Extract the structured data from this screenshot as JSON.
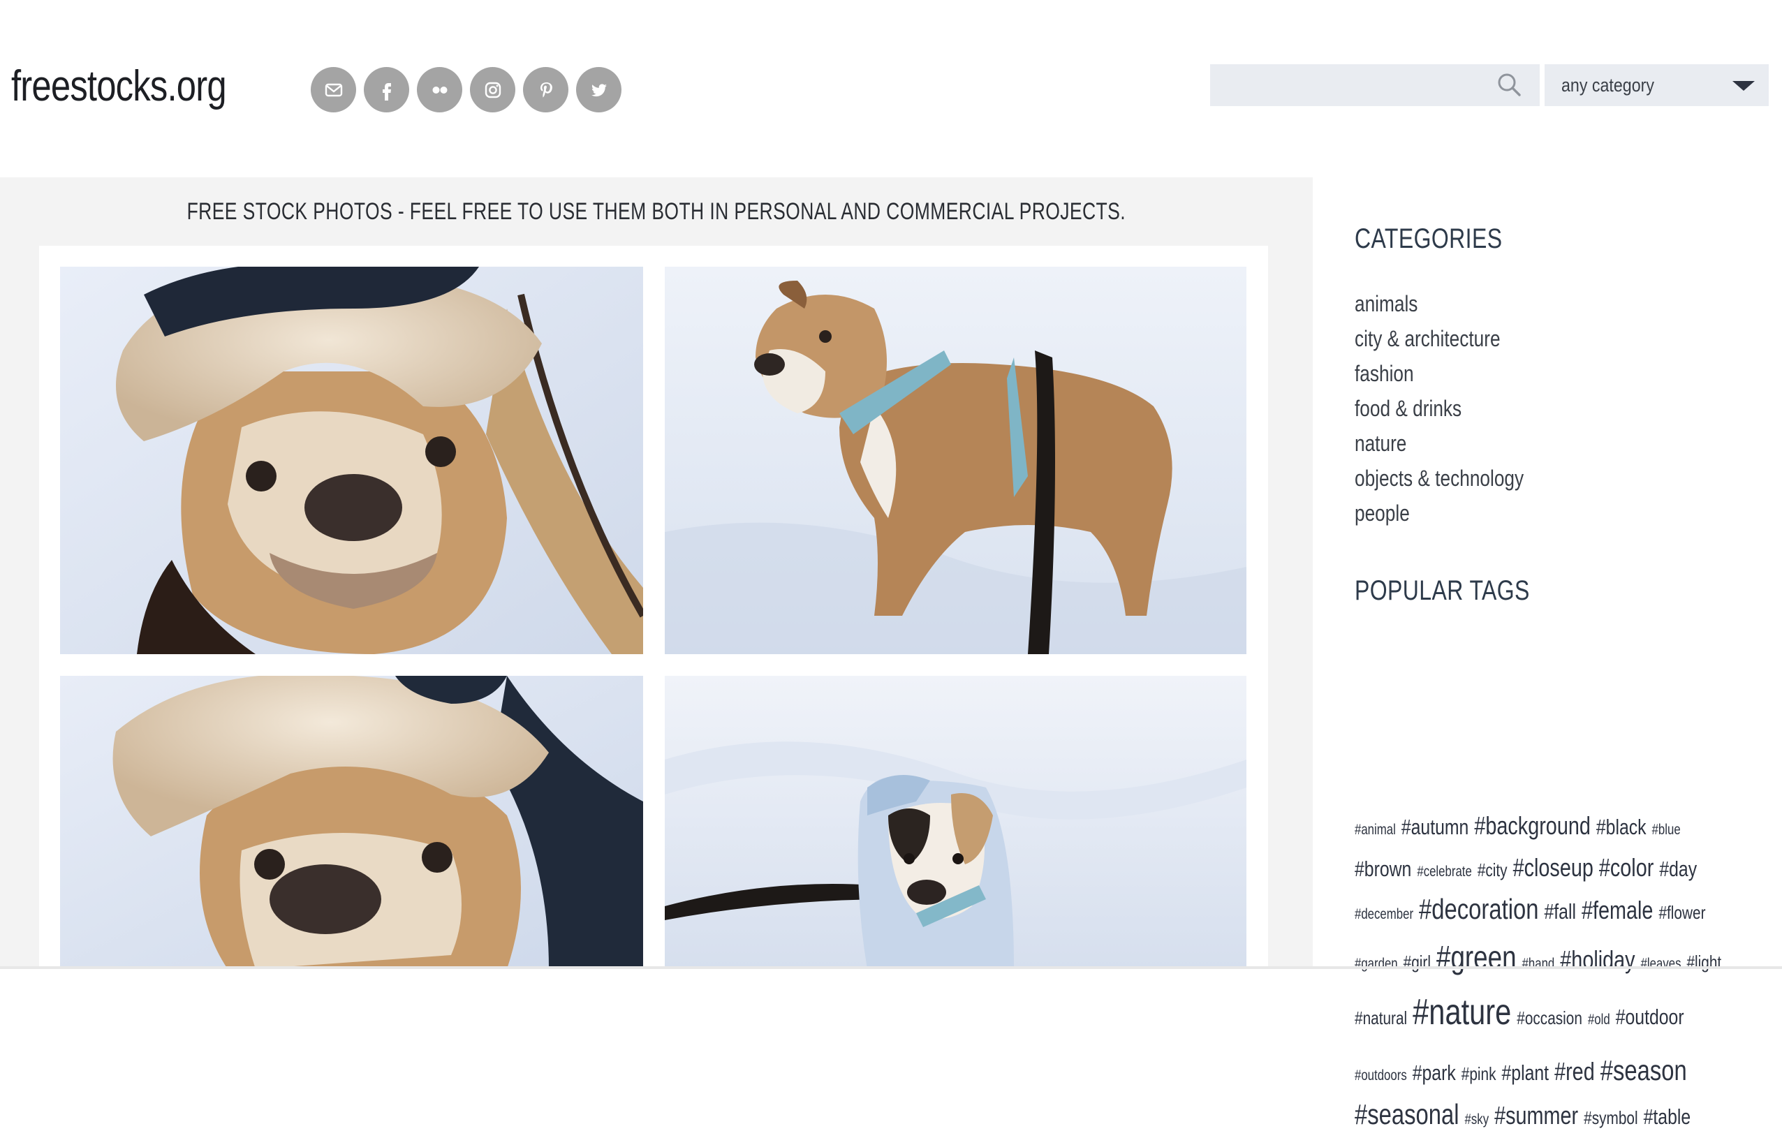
{
  "header": {
    "logo": "freestocks.org",
    "social": [
      {
        "name": "email-icon"
      },
      {
        "name": "facebook-icon"
      },
      {
        "name": "flickr-icon"
      },
      {
        "name": "instagram-icon"
      },
      {
        "name": "pinterest-icon"
      },
      {
        "name": "twitter-icon"
      }
    ],
    "search": {
      "value": "",
      "placeholder": ""
    },
    "category_select": {
      "selected": "any category"
    }
  },
  "main": {
    "tagline": "FREE STOCK PHOTOS - FEEL FREE TO USE THEM BOTH IN PERSONAL AND COMMERCIAL PROJECTS."
  },
  "sidebar": {
    "categories_heading": "CATEGORIES",
    "categories": [
      "animals",
      "city & architecture",
      "fashion",
      "food & drinks",
      "nature",
      "objects & technology",
      "people"
    ],
    "tags_heading": "POPULAR TAGS",
    "tag_lines": [
      [
        [
          "#animal",
          1
        ],
        [
          "#autumn",
          3
        ],
        [
          "#background",
          4
        ],
        [
          "#black",
          3
        ],
        [
          "#blue",
          1
        ]
      ],
      [
        [
          "#brown",
          3
        ],
        [
          "#celebrate",
          1
        ],
        [
          "#city",
          2
        ],
        [
          "#closeup",
          4
        ],
        [
          "#color",
          4
        ],
        [
          "#day",
          3
        ]
      ],
      [
        [
          "#december",
          1
        ],
        [
          "#decoration",
          5
        ],
        [
          "#fall",
          3
        ],
        [
          "#female",
          4
        ],
        [
          "#flower",
          2
        ]
      ],
      [
        [
          "#garden",
          1
        ],
        [
          "#girl",
          2
        ],
        [
          "#green",
          6
        ],
        [
          "#hand",
          1
        ],
        [
          "#holiday",
          4
        ],
        [
          "#leaves",
          1
        ],
        [
          "#light",
          2
        ]
      ],
      [
        [
          "#natural",
          2
        ],
        [
          "#nature",
          7
        ],
        [
          "#occasion",
          2
        ],
        [
          "#old",
          1
        ],
        [
          "#outdoor",
          3
        ]
      ],
      [
        [
          "#outdoors",
          1
        ],
        [
          "#park",
          3
        ],
        [
          "#pink",
          2
        ],
        [
          "#plant",
          3
        ],
        [
          "#red",
          4
        ],
        [
          "#season",
          5
        ]
      ],
      [
        [
          "#seasonal",
          5
        ],
        [
          "#sky",
          1
        ],
        [
          "#summer",
          4
        ],
        [
          "#symbol",
          2
        ],
        [
          "#table",
          3
        ]
      ]
    ]
  },
  "colors": {
    "social_circle": "#a4a4a4",
    "search_bg": "#e9ecf1",
    "main_bg": "#f3f3f3",
    "heading": "#2d3a4a"
  }
}
